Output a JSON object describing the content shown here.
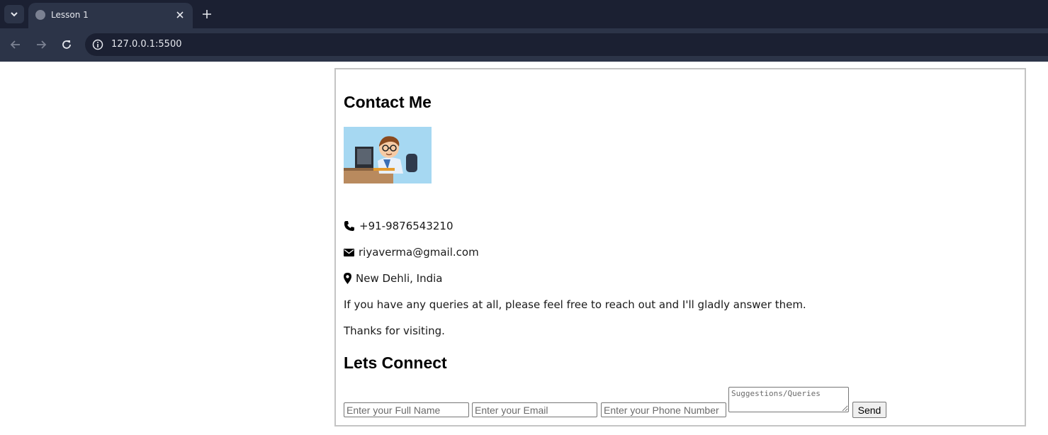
{
  "browser": {
    "tab_title": "Lesson 1",
    "url": "127.0.0.1:5500"
  },
  "page": {
    "contact_heading": "Contact Me",
    "phone": "+91-9876543210",
    "email": "riyaverma@gmail.com",
    "location": "New Dehli, India",
    "message": "If you have any queries at all, please feel free to reach out and I'll gladly answer them.",
    "thanks": "Thanks for visiting.",
    "connect_heading": "Lets Connect"
  },
  "form": {
    "name_placeholder": "Enter your Full Name",
    "email_placeholder": "Enter your Email",
    "phone_placeholder": "Enter your Phone Number",
    "queries_placeholder": "Suggestions/Queries",
    "send_label": "Send"
  },
  "icons": {
    "phone": "phone-icon",
    "email": "envelope-icon",
    "location": "map-marker-icon"
  },
  "colors": {
    "chrome_dark": "#1b2032",
    "chrome_tab": "#2c3448",
    "border": "#c4c4c4"
  }
}
